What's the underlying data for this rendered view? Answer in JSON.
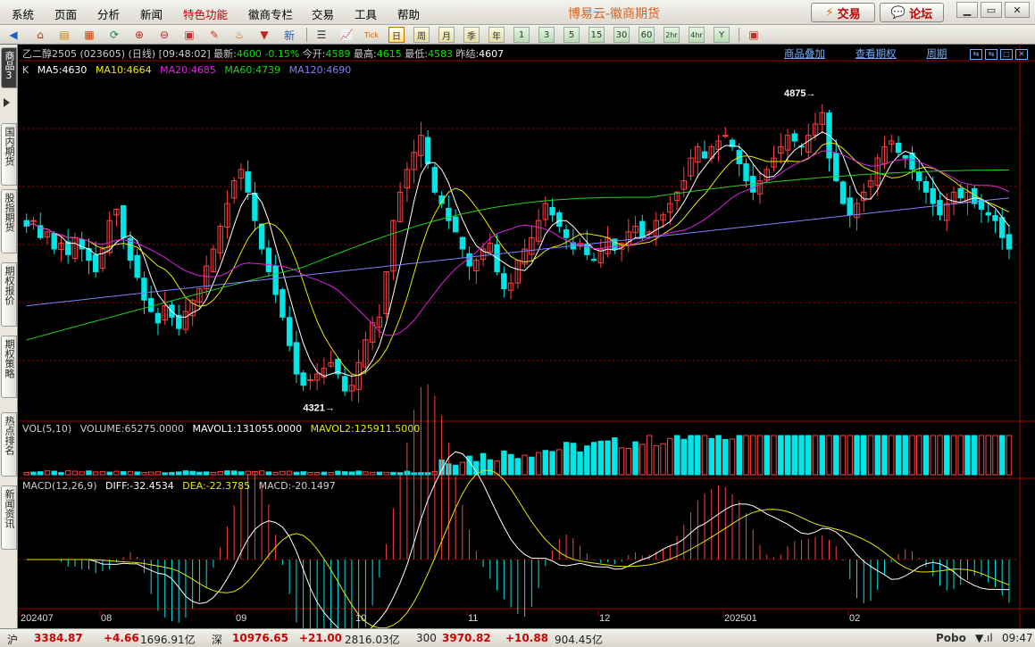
{
  "menu": {
    "items": [
      "系统",
      "页面",
      "分析",
      "新闻",
      "特色功能",
      "徽商专栏",
      "交易",
      "工具",
      "帮助"
    ],
    "app_title": "博易云-徽商期货",
    "trade_button": "交易",
    "forum_button": "论坛"
  },
  "toolbar": {
    "periods": [
      "日",
      "周",
      "月",
      "季",
      "年",
      "1",
      "3",
      "5",
      "15",
      "30",
      "60",
      "2hr",
      "4hr",
      "Y"
    ],
    "active_period": "日"
  },
  "side_tabs": [
    "商品",
    "国内期货",
    "股指期货",
    "期权报价",
    "期权策略",
    "热点排名",
    "新闻资讯"
  ],
  "side_tab_sub": "3",
  "header": {
    "symbol": "乙二醇2505 (023605) (日线)",
    "time": "[09:48:02]",
    "latest_label": "最新:",
    "latest_value": "4600",
    "change": "-0.15%",
    "open_label": "今开:",
    "open_value": "4589",
    "high_label": "最高:",
    "high_value": "4615",
    "low_label": "最低:",
    "low_value": "4583",
    "prev_close_label": "昨结:",
    "prev_close_value": "4607",
    "links": [
      "商品叠加",
      "查看期权",
      "周期"
    ]
  },
  "ma_legend": {
    "k": "K",
    "ma5": "MA5:4630",
    "ma10": "MA10:4664",
    "ma20": "MA20:4685",
    "ma60": "MA60:4739",
    "ma120": "MA120:4690"
  },
  "vol_legend": {
    "title": "VOL(5,10)",
    "volume": "VOLUME:65275.0000",
    "mavol1": "MAVOL1:131055.0000",
    "mavol2": "MAVOL2:125911.5000"
  },
  "macd_legend": {
    "title": "MACD(12,26,9)",
    "diff": "DIFF:-32.4534",
    "dea": "DEA:-22.3785",
    "macd": "MACD:-20.1497"
  },
  "annotations": {
    "high": "4875",
    "low": "4321"
  },
  "x_axis": [
    "202407",
    "08",
    "09",
    "10",
    "11",
    "12",
    "202501",
    "02"
  ],
  "status": {
    "sh_label": "沪",
    "sh_value": "3384.87",
    "sh_change": "+4.66",
    "sh_amount": "1696.91亿",
    "sz_label": "深",
    "sz_value": "10976.65",
    "sz_change": "+21.00",
    "sz_amount": "2816.03亿",
    "c300_label": "300",
    "c300_value": "3970.82",
    "c300_change": "+10.88",
    "c300_amount": "904.45亿",
    "brand": "Pobo",
    "clock": "09:47"
  },
  "colors": {
    "up": "#ff4040",
    "down": "#00e5e5",
    "ma5": "#ffffff",
    "ma10": "#e8e800",
    "ma20": "#e020e0",
    "ma60": "#20d020",
    "ma120": "#8080ff",
    "grid": "#a00000"
  },
  "chart_data": {
    "type": "candlestick",
    "y_range": [
      4300,
      4900
    ],
    "annotation_high": 4875,
    "annotation_low": 4321,
    "closes": [
      4640,
      4650,
      4620,
      4630,
      4600,
      4610,
      4590,
      4620,
      4600,
      4580,
      4560,
      4600,
      4650,
      4670,
      4620,
      4580,
      4550,
      4510,
      4490,
      4470,
      4500,
      4480,
      4460,
      4490,
      4510,
      4530,
      4570,
      4600,
      4640,
      4680,
      4720,
      4740,
      4700,
      4650,
      4600,
      4560,
      4520,
      4480,
      4430,
      4380,
      4360,
      4370,
      4380,
      4390,
      4400,
      4380,
      4350,
      4360,
      4400,
      4440,
      4470,
      4480,
      4560,
      4650,
      4700,
      4740,
      4770,
      4800,
      4750,
      4700,
      4680,
      4650,
      4630,
      4600,
      4570,
      4580,
      4600,
      4610,
      4560,
      4530,
      4540,
      4580,
      4600,
      4620,
      4650,
      4680,
      4660,
      4640,
      4620,
      4600,
      4610,
      4590,
      4580,
      4600,
      4620,
      4600,
      4610,
      4630,
      4640,
      4620,
      4630,
      4650,
      4660,
      4680,
      4700,
      4720,
      4760,
      4780,
      4760,
      4780,
      4790,
      4800,
      4780,
      4750,
      4720,
      4700,
      4720,
      4740,
      4760,
      4780,
      4800,
      4790,
      4780,
      4800,
      4820,
      4840,
      4760,
      4720,
      4680,
      4660,
      4680,
      4700,
      4720,
      4760,
      4780,
      4790,
      4770,
      4760,
      4740,
      4720,
      4700,
      4680,
      4660,
      4680,
      4700,
      4690,
      4700,
      4680,
      4670,
      4660,
      4650,
      4620,
      4600
    ],
    "ma120_start": 4500,
    "ma120_end": 4690,
    "ma60_start": 4440,
    "ma60_end": 4739
  }
}
